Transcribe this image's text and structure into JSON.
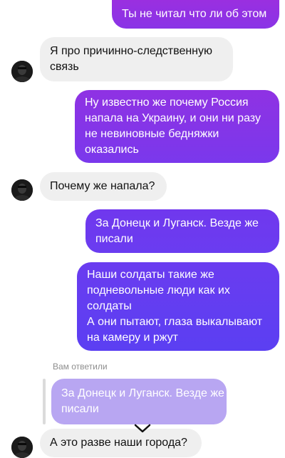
{
  "colors": {
    "outgoing_top": "#9a2fe0",
    "outgoing_bottom": "#5b3ff2",
    "incoming_bg": "#efefef",
    "quoted_bg": "#b8a6f2"
  },
  "messages": [
    {
      "direction": "out",
      "lines": [
        "Ты не читал что ли об этом"
      ]
    },
    {
      "direction": "in",
      "avatar": "avatar",
      "lines": [
        "Я про причинно-следственную",
        "связь"
      ]
    },
    {
      "direction": "out",
      "lines": [
        "Ну известно же почему Россия",
        "напала на Украину, и они ни разу",
        "не невиновные бедняжки",
        "оказались"
      ]
    },
    {
      "direction": "in",
      "avatar": "avatar",
      "lines": [
        "Почему же напала?"
      ]
    },
    {
      "direction": "out",
      "lines": [
        "За Донецк и Луганск. Везде же",
        "писали"
      ]
    },
    {
      "direction": "out",
      "lines": [
        "Наши солдаты такие же",
        "подневольные люди как их",
        "солдаты",
        "А они пытают, глаза выкалывают",
        "на камеру и ржут"
      ]
    },
    {
      "direction": "in",
      "avatar": "avatar",
      "lines": [
        "А это разве наши города?"
      ]
    }
  ],
  "reply": {
    "caption": "Вам ответили",
    "quoted_lines": [
      "За Донецк и Луганск. Везде же",
      "писали"
    ]
  },
  "scroll_down_icon": "chevron-down-icon"
}
